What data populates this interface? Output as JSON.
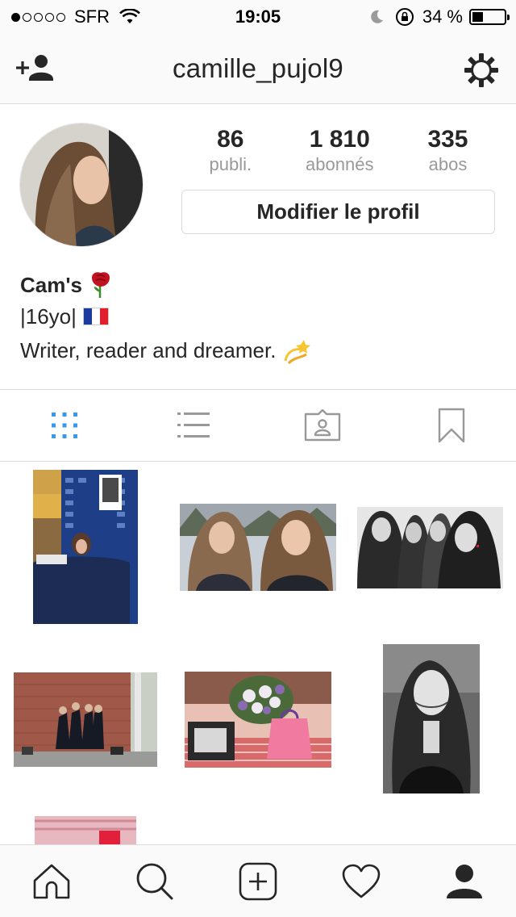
{
  "status_bar": {
    "carrier": "SFR",
    "time": "19:05",
    "battery_text": "34 %",
    "battery_level": 0.34,
    "signal_dots_filled": 1,
    "signal_dots_total": 5
  },
  "nav": {
    "username": "camille_pujol9",
    "left_icon": "add-user-icon",
    "right_icon": "settings-gear-icon"
  },
  "profile": {
    "stats": [
      {
        "value": "86",
        "label": "publi."
      },
      {
        "value": "1 810",
        "label": "abonnés"
      },
      {
        "value": "335",
        "label": "abos"
      }
    ],
    "edit_button": "Modifier le profil",
    "bio": {
      "name": "Cam's",
      "name_emoji": "rose-emoji",
      "age": "|16yo|",
      "age_emoji": "french-flag-emoji",
      "tagline": "Writer, reader and dreamer.",
      "tagline_emoji": "dizzy-emoji"
    }
  },
  "tabs": [
    {
      "icon": "grid-icon",
      "active": true
    },
    {
      "icon": "list-icon",
      "active": false
    },
    {
      "icon": "tagged-icon",
      "active": false
    },
    {
      "icon": "bookmark-icon",
      "active": false
    }
  ],
  "bottom_nav": [
    {
      "icon": "home-icon"
    },
    {
      "icon": "search-icon"
    },
    {
      "icon": "new-post-icon"
    },
    {
      "icon": "heart-icon"
    },
    {
      "icon": "profile-icon"
    }
  ],
  "colors": {
    "accent": "#3897f0",
    "text": "#262626",
    "muted": "#999999",
    "border": "#dbdbdb"
  }
}
